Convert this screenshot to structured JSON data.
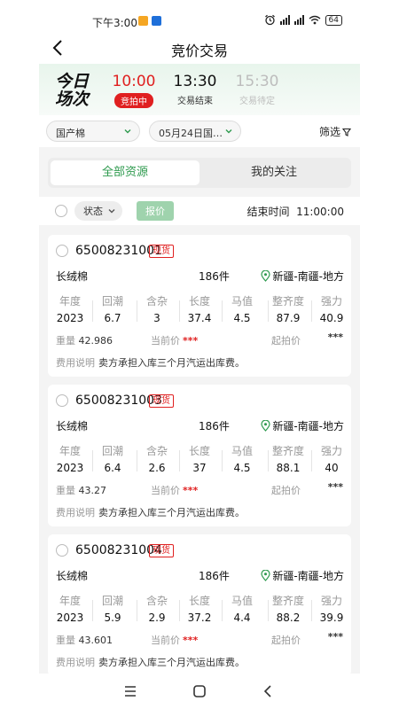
{
  "status_bar": {
    "time": "下午3:00",
    "app_icon_colors": [
      "#f5a623",
      "#1e6fd9"
    ],
    "battery": "64"
  },
  "header": {
    "title": "竞价交易",
    "back_icon": "back-arrow-icon"
  },
  "session": {
    "today_label": "今日场次",
    "slots": [
      {
        "time": "10:00",
        "status": "竞拍中",
        "state": "active"
      },
      {
        "time": "13:30",
        "status": "交易结束",
        "state": "ended"
      },
      {
        "time": "15:30",
        "status": "交易待定",
        "state": "pending"
      }
    ]
  },
  "filters": {
    "origin": "国产棉",
    "date": "05月24日国…",
    "filter_label": "筛选"
  },
  "tabs": {
    "all": "全部资源",
    "following": "我的关注"
  },
  "toolbar": {
    "state_label": "状态",
    "quote_label": "报价",
    "end_time_label": "结束时间",
    "end_time": "11:00:00"
  },
  "spec_labels": [
    "年度",
    "回潮",
    "含杂",
    "长度",
    "马值",
    "整齐度",
    "强力"
  ],
  "labels": {
    "weight": "重量",
    "current_price": "当前价",
    "start_price": "起拍价",
    "fee": "费用说明",
    "spot": "现货",
    "masked_price": "***"
  },
  "lots": [
    {
      "id": "65008231001",
      "type": "长绒棉",
      "pieces": "186件",
      "location": "新疆-南疆-地方",
      "specs": [
        "2023",
        "6.7",
        "3",
        "37.4",
        "4.5",
        "87.9",
        "40.9"
      ],
      "weight": "42.986",
      "fee": "卖方承担入库三个月汽运出库费。"
    },
    {
      "id": "65008231003",
      "type": "长绒棉",
      "pieces": "186件",
      "location": "新疆-南疆-地方",
      "specs": [
        "2023",
        "6.4",
        "2.6",
        "37",
        "4.5",
        "88.1",
        "40"
      ],
      "weight": "43.27",
      "fee": "卖方承担入库三个月汽运出库费。"
    },
    {
      "id": "65008231004",
      "type": "长绒棉",
      "pieces": "186件",
      "location": "新疆-南疆-地方",
      "specs": [
        "2023",
        "5.9",
        "2.9",
        "37.2",
        "4.4",
        "88.2",
        "39.9"
      ],
      "weight": "43.601",
      "fee": "卖方承担入库三个月汽运出库费。"
    }
  ],
  "colors": {
    "accent_green": "#2e9a4e",
    "live_red": "#e02020",
    "quote_button": "#9fd3ad"
  }
}
